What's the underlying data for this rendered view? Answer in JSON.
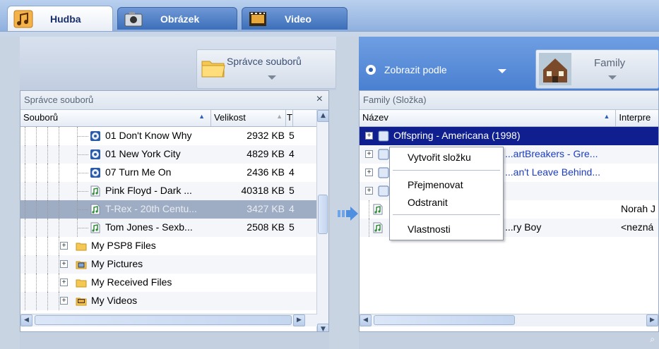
{
  "tabs": [
    {
      "label": "Hudba",
      "icon": "music-note-icon"
    },
    {
      "label": "Obrázek",
      "icon": "camera-icon"
    },
    {
      "label": "Video",
      "icon": "film-icon"
    }
  ],
  "toolbar_left": {
    "file_manager_label": "Správce souborů"
  },
  "toolbar_right": {
    "view_by_label": "Zobrazit podle",
    "family_label": "Family"
  },
  "left_panel": {
    "title": "Správce souborů",
    "columns": {
      "name": "Souborů",
      "size": "Velikost",
      "extra": "Ti"
    },
    "rows": [
      {
        "name": "01 Don't Know Why",
        "size": "2932 KB",
        "extra": "5",
        "type": "audio-cd"
      },
      {
        "name": "01 New York City",
        "size": "4829 KB",
        "extra": "4",
        "type": "audio-cd"
      },
      {
        "name": "07 Turn Me On",
        "size": "2436 KB",
        "extra": "4",
        "type": "audio-cd"
      },
      {
        "name": "Pink Floyd - Dark ...",
        "size": "40318 KB",
        "extra": "5",
        "type": "music-file"
      },
      {
        "name": "T-Rex - 20th Centu...",
        "size": "3427 KB",
        "extra": "4",
        "type": "music-file"
      },
      {
        "name": "Tom Jones - Sexb...",
        "size": "2508 KB",
        "extra": "5",
        "type": "music-file"
      },
      {
        "name": "My PSP8 Files",
        "size": "",
        "extra": "",
        "type": "folder"
      },
      {
        "name": "My Pictures",
        "size": "",
        "extra": "",
        "type": "pictures-folder"
      },
      {
        "name": "My Received Files",
        "size": "",
        "extra": "",
        "type": "folder"
      },
      {
        "name": "My Videos",
        "size": "",
        "extra": "",
        "type": "videos-folder"
      }
    ]
  },
  "right_panel": {
    "title": "Family (Složka)",
    "columns": {
      "name": "Název",
      "artist": "Interpre"
    },
    "rows": [
      {
        "name": "Offspring - Americana (1998)",
        "artist": ""
      },
      {
        "name": "...artBreakers - Gre...",
        "artist": ""
      },
      {
        "name": "...an't Leave Behind...",
        "artist": ""
      },
      {
        "name": "",
        "artist": ""
      },
      {
        "name": "",
        "artist": "Norah J"
      },
      {
        "name": "...ry Boy",
        "artist": "<nezná"
      }
    ]
  },
  "context_menu": {
    "items": [
      "Vytvořit složku",
      "Přejmenovat",
      "Odstranit",
      "Vlastnosti"
    ]
  },
  "colors": {
    "selected_blue": "#0f1f8f",
    "selected_gray": "#9fadc4",
    "tab_active_text": "#1a2f6b"
  }
}
